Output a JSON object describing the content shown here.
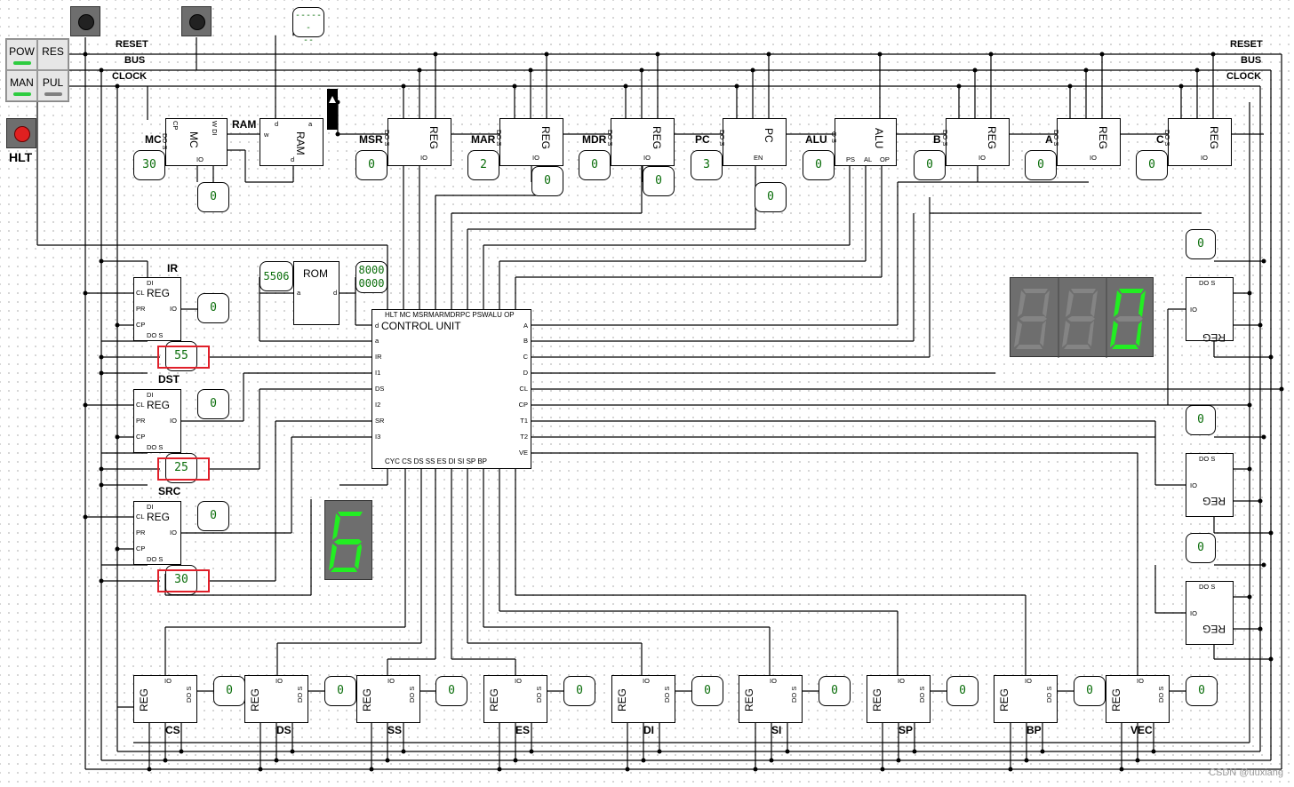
{
  "buses": {
    "reset": "RESET",
    "bus": "BUS",
    "clock": "CLOCK"
  },
  "panel": {
    "pow": "POW",
    "res": "RES",
    "man": "MAN",
    "pul": "PUL",
    "hlt": "HLT",
    "pow_color": "#2ecc40",
    "man_color": "#2ecc40",
    "pul_color": "#808080",
    "hlt_color": "#e02020"
  },
  "probe_top": {
    "line1": "------",
    "line2": "--"
  },
  "top_registers": [
    {
      "name": "MC",
      "type": "MC",
      "value": "30"
    },
    {
      "name": "RAM",
      "type": "RAM",
      "value": ""
    },
    {
      "name": "MSR",
      "type": "REG",
      "value": "0"
    },
    {
      "name": "MAR",
      "type": "REG",
      "value": "2"
    },
    {
      "name": "MDR",
      "type": "REG",
      "value": "0"
    },
    {
      "name": "PC",
      "type": "PC",
      "value": "3"
    },
    {
      "name": "ALU",
      "type": "ALU",
      "value": "0"
    },
    {
      "name": "B",
      "type": "REG",
      "value": "0"
    },
    {
      "name": "A",
      "type": "REG",
      "value": "0"
    },
    {
      "name": "C",
      "type": "REG",
      "value": "0"
    }
  ],
  "top_extra_probes": {
    "mc_out": "0",
    "mar_out": "0",
    "mdr_out": "0",
    "pc_out": "0"
  },
  "left_registers": [
    {
      "name": "IR",
      "io": "0",
      "out": "55"
    },
    {
      "name": "DST",
      "io": "0",
      "out": "25"
    },
    {
      "name": "SRC",
      "io": "0",
      "out": "30"
    }
  ],
  "rom": {
    "title": "ROM",
    "addr": "5506",
    "data1": "8000",
    "data2": "0000",
    "a": "a",
    "d": "d"
  },
  "control_unit": {
    "title": "CONTROL UNIT",
    "top_pins": "HLT  MC  MSRMARMDRPC   PSWALU  OP",
    "left_pins": [
      "d",
      "a",
      "IR",
      "I1",
      "DS",
      "I2",
      "SR",
      "I3"
    ],
    "right_pins": [
      "A",
      "B",
      "C",
      "D",
      "CL",
      "CP",
      "T1",
      "T2",
      "VE"
    ],
    "bottom_pins": "CYC CS   DS   SS   ES   DI   SI   SP   BP"
  },
  "cycle_display": "6",
  "main_display": [
    "",
    "",
    "0"
  ],
  "right_registers": [
    {
      "value": "0"
    },
    {
      "value": "0"
    },
    {
      "value": "0"
    }
  ],
  "bottom_registers": [
    {
      "name": "CS",
      "value": "0"
    },
    {
      "name": "DS",
      "value": "0"
    },
    {
      "name": "SS",
      "value": "0"
    },
    {
      "name": "ES",
      "value": "0"
    },
    {
      "name": "DI",
      "value": "0"
    },
    {
      "name": "SI",
      "value": "0"
    },
    {
      "name": "SP",
      "value": "0"
    },
    {
      "name": "BP",
      "value": "0"
    },
    {
      "name": "VEC",
      "value": "0"
    }
  ],
  "reg_pins": {
    "reg": "REG",
    "di": "DI",
    "cl": "CL",
    "pr": "PR",
    "cp": "CP",
    "do": "DO",
    "s": "S",
    "io": "IO"
  },
  "watermark": "CSDN @uuxiang"
}
